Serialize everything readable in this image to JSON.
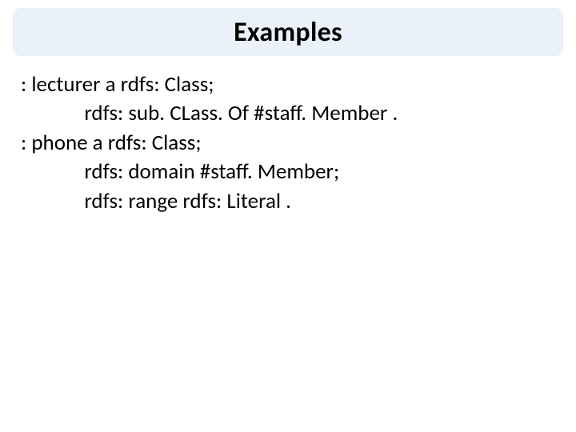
{
  "title": "Examples",
  "content": {
    "l1": ": lecturer a rdfs: Class;",
    "l2": "             rdfs: sub. CLass. Of #staff. Member .",
    "l3": "",
    "l4": ": phone a rdfs: Class;",
    "l5": "             rdfs: domain #staff. Member;",
    "l6": "             rdfs: range rdfs: Literal ."
  }
}
